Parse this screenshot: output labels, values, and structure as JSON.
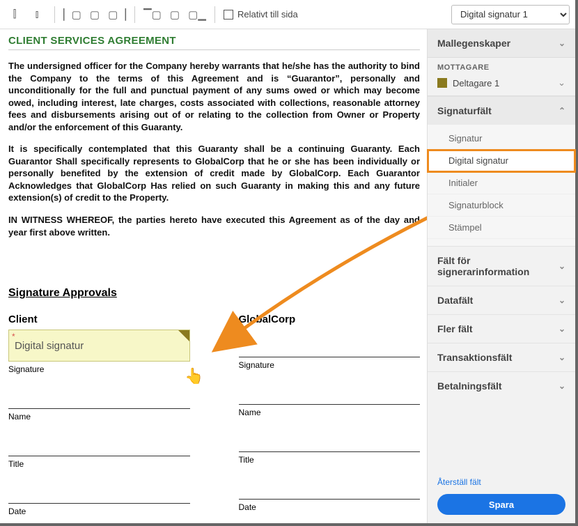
{
  "toolbar": {
    "rel_label": "Relativt till sida",
    "dropdown_value": "Digital signatur 1"
  },
  "doc": {
    "title": "CLIENT SERVICES AGREEMENT",
    "p1": "The undersigned officer for the Company hereby warrants that he/she has the authority to bind the Company to the terms of this Agreement and is “Guarantor”, personally and unconditionally for the full and punctual payment of any sums owed or which may become owed, including interest, late charges, costs associated with collections, reasonable attorney fees and disbursements arising out of or relating to the collection from Owner or Property and/or the enforcement of this Guaranty.",
    "p2": "It is specifically contemplated that this Guaranty shall be a continuing Guaranty. Each Guarantor Shall specifically represents to GlobalCorp that he or she has been individually or personally benefited by the extension of credit made by GlobalCorp. Each Guarantor Acknowledges that GlobalCorp Has relied on such Guaranty in making this and any future extension(s) of credit to the Property.",
    "witness": "IN WITNESS WHEREOF, the parties hereto have executed this Agreement as of the day and year first above written.",
    "approvals_heading": "Signature Approvals",
    "client_heading": "Client",
    "global_heading": "GlobalCorp",
    "field_placeholder": "Digital signatur",
    "signature_label": "Signature",
    "name_label": "Name",
    "title_label": "Title",
    "date_label": "Date"
  },
  "side": {
    "template_props": "Mallegenskaper",
    "recipients_label": "MOTTAGARE",
    "participant": "Deltagare 1",
    "groups": {
      "signature": {
        "label": "Signaturfält",
        "items": [
          "Signatur",
          "Digital signatur",
          "Initialer",
          "Signaturblock",
          "Stämpel"
        ]
      },
      "signer_info": "Fält för signerarinformation",
      "data": "Datafält",
      "more": "Fler fält",
      "transaction": "Transaktionsfält",
      "payment": "Betalningsfält"
    },
    "reset": "Återställ fält",
    "save": "Spara"
  }
}
